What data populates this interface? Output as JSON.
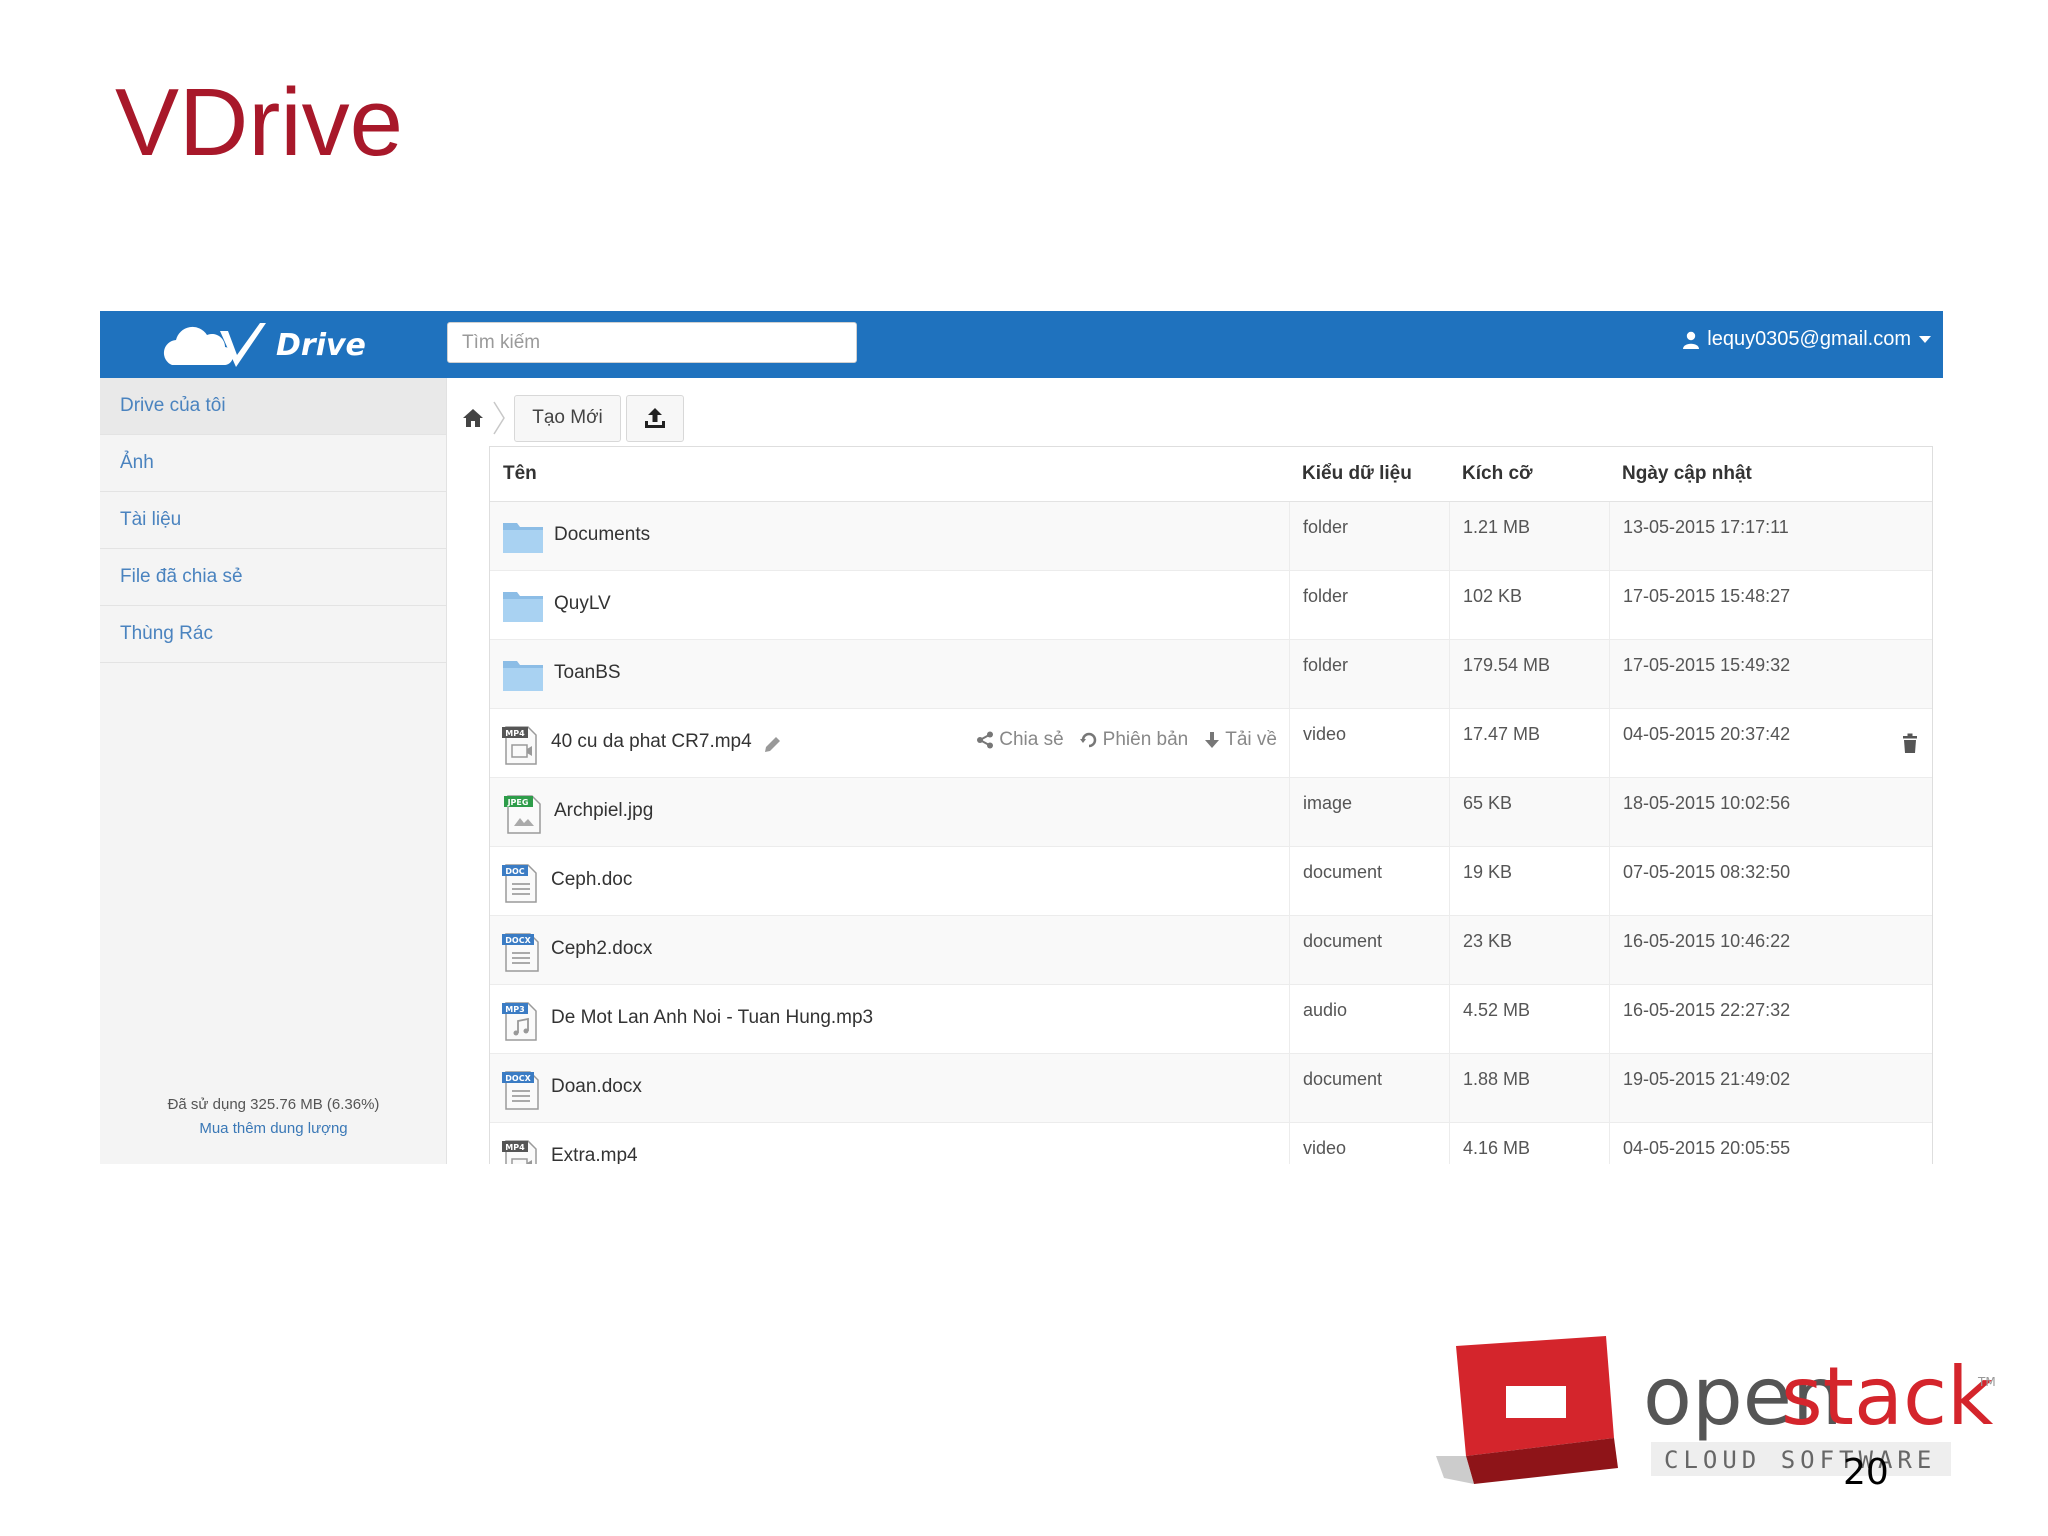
{
  "slide": {
    "title": "VDrive",
    "page_number": "20"
  },
  "app": {
    "brand": "Drive",
    "search": {
      "placeholder": "Tìm kiếm",
      "value": ""
    },
    "user_email": "lequy0305@gmail.com",
    "sidebar": {
      "items": [
        {
          "label": "Drive của tôi"
        },
        {
          "label": "Ảnh"
        },
        {
          "label": "Tài liệu"
        },
        {
          "label": "File đã chia sẻ"
        },
        {
          "label": "Thùng Rác"
        }
      ],
      "usage_text": "Đã sử dụng 325.76 MB (6.36%)",
      "buy_more_label": "Mua thêm dung lượng"
    },
    "toolbar": {
      "new_label": "Tạo Mới"
    },
    "table": {
      "headers": {
        "name": "Tên",
        "type": "Kiểu dữ liệu",
        "size": "Kích cỡ",
        "date": "Ngày cập nhật"
      },
      "rows": [
        {
          "name": "Documents",
          "icon": "folder-icon",
          "type": "folder",
          "size": "1.21 MB",
          "date": "13-05-2015 17:17:11"
        },
        {
          "name": "QuyLV",
          "icon": "folder-icon",
          "type": "folder",
          "size": "102 KB",
          "date": "17-05-2015 15:48:27"
        },
        {
          "name": "ToanBS",
          "icon": "folder-icon",
          "type": "folder",
          "size": "179.54 MB",
          "date": "17-05-2015 15:49:32"
        },
        {
          "name": "40 cu da phat CR7.mp4",
          "icon": "mp4-file-icon",
          "badge": "MP4",
          "type": "video",
          "size": "17.47 MB",
          "date": "04-05-2015 20:37:42"
        },
        {
          "name": "Archpiel.jpg",
          "icon": "jpeg-file-icon",
          "badge": "JPEG",
          "type": "image",
          "size": "65 KB",
          "date": "18-05-2015 10:02:56"
        },
        {
          "name": "Ceph.doc",
          "icon": "doc-file-icon",
          "badge": "DOC",
          "type": "document",
          "size": "19 KB",
          "date": "07-05-2015 08:32:50"
        },
        {
          "name": "Ceph2.docx",
          "icon": "docx-file-icon",
          "badge": "DOCX",
          "type": "document",
          "size": "23 KB",
          "date": "16-05-2015 10:46:22"
        },
        {
          "name": "De Mot Lan Anh Noi - Tuan Hung.mp3",
          "icon": "mp3-file-icon",
          "badge": "MP3",
          "type": "audio",
          "size": "4.52 MB",
          "date": "16-05-2015 22:27:32"
        },
        {
          "name": "Doan.docx",
          "icon": "docx-file-icon",
          "badge": "DOCX",
          "type": "document",
          "size": "1.88 MB",
          "date": "19-05-2015 21:49:02"
        },
        {
          "name": "Extra.mp4",
          "icon": "mp4-file-icon",
          "badge": "MP4",
          "type": "video",
          "size": "4.16 MB",
          "date": "04-05-2015 20:05:55"
        }
      ],
      "row_actions": {
        "share": "Chia sẻ",
        "versions": "Phiên bản",
        "download": "Tải về"
      }
    }
  },
  "footer_logo": {
    "word1": "open",
    "word2": "stack",
    "tm": "TM",
    "subtitle": "CLOUD SOFTWARE"
  },
  "colors": {
    "title": "#a8182a",
    "topbar": "#1f72be",
    "link": "#4a83bf",
    "openstack_red": "#d4252c"
  }
}
